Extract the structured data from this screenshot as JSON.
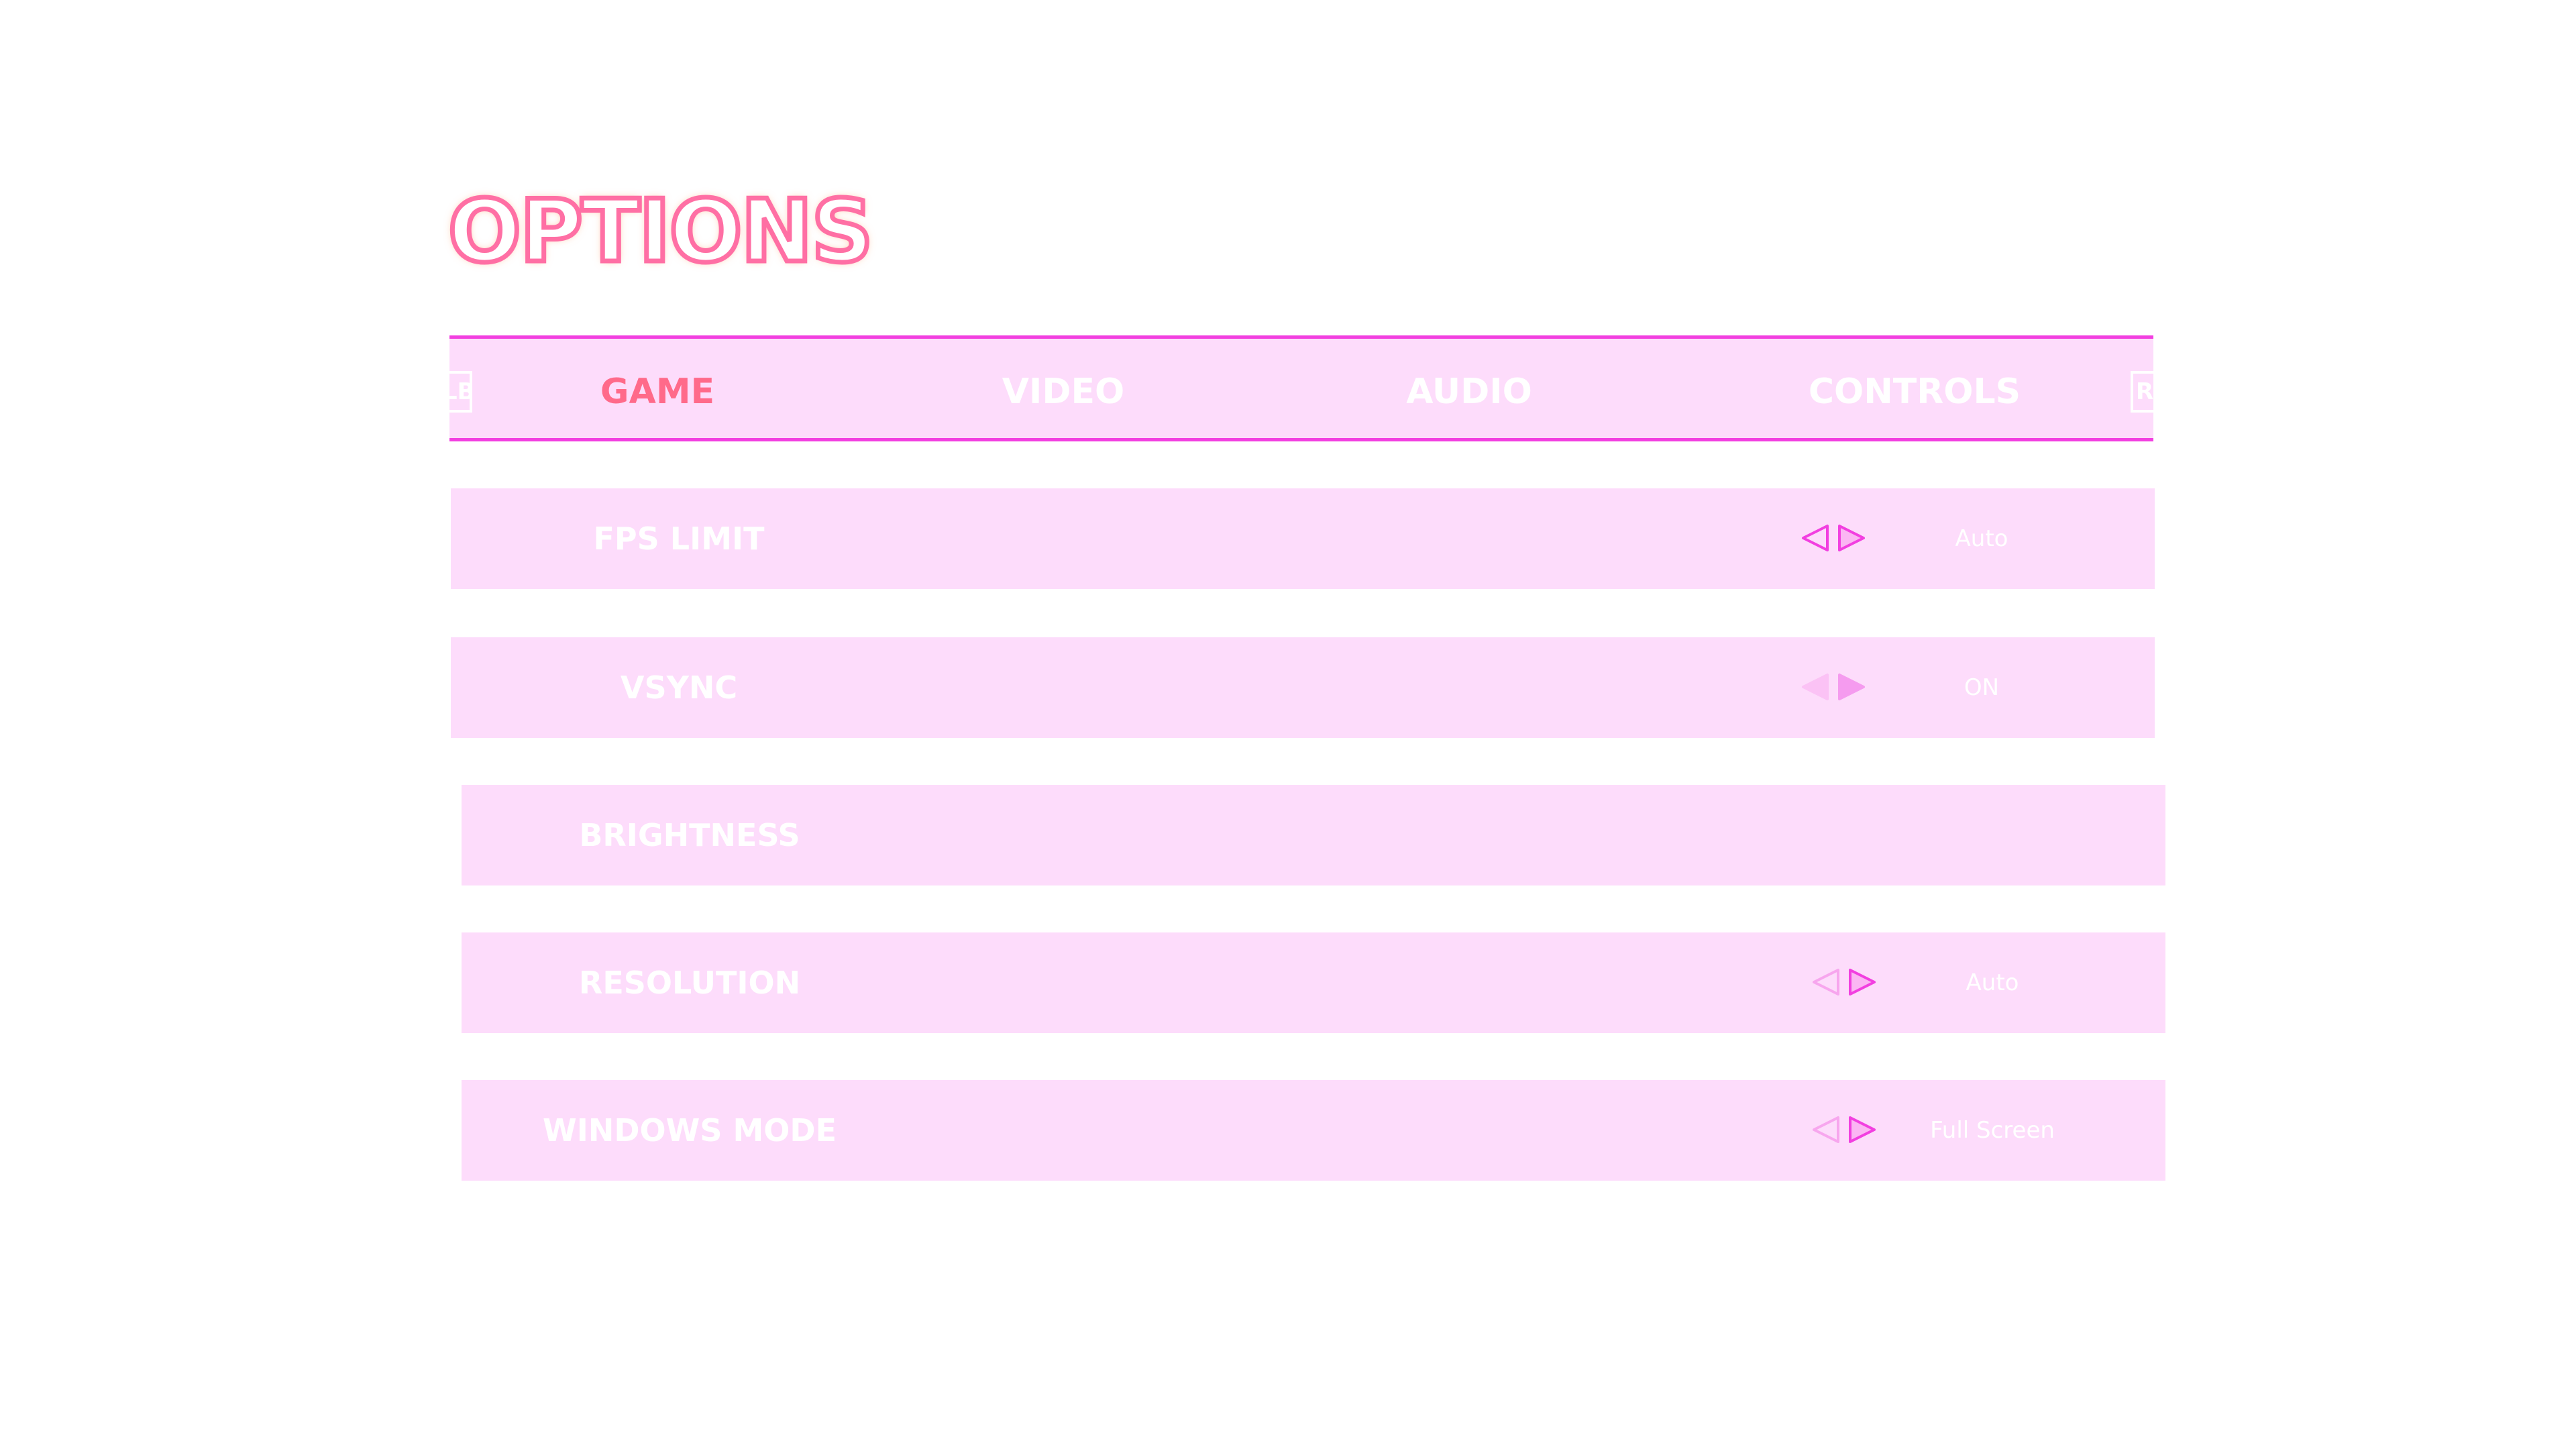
{
  "title": "OPTIONS",
  "colors": {
    "accent": "#f23fe0",
    "panel": "#fddcfb",
    "active_tab": "#ff6a8a",
    "arrow": "#f23fe0"
  },
  "bumpers": {
    "left": "LB",
    "right": "RB"
  },
  "tabs": [
    {
      "label": "GAME",
      "active": true
    },
    {
      "label": "VIDEO",
      "active": false
    },
    {
      "label": "AUDIO",
      "active": false
    },
    {
      "label": "CONTROLS",
      "active": false
    }
  ],
  "options": [
    {
      "label": "FPS LIMIT",
      "value": "Auto",
      "has_arrows": true
    },
    {
      "label": "VSYNC",
      "value": "ON",
      "has_arrows": true
    },
    {
      "label": "BRIGHTNESS",
      "value": "",
      "has_arrows": false
    },
    {
      "label": "RESOLUTION",
      "value": "Auto",
      "has_arrows": true
    },
    {
      "label": "WINDOWS MODE",
      "value": "Full Screen",
      "has_arrows": true
    }
  ]
}
